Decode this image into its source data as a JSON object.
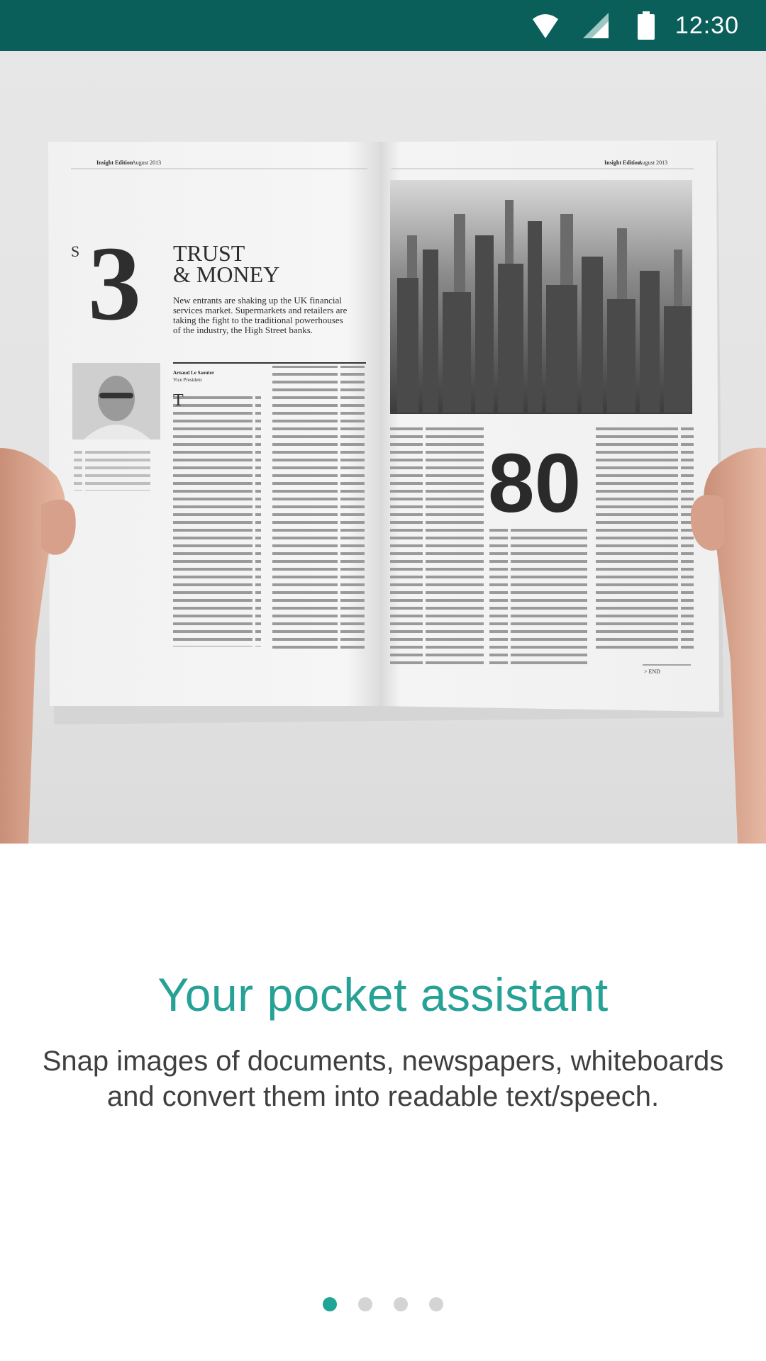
{
  "status_bar": {
    "time": "12:30",
    "icons": [
      "wifi-icon",
      "cell-signal-icon",
      "battery-icon"
    ]
  },
  "hero": {
    "magazine": {
      "left_page": {
        "edition": "Insight Edition",
        "edition_date": "August 2013",
        "number": "3",
        "heading_line1": "TRUST",
        "heading_line2": "& MONEY",
        "intro_lines": [
          "New entrants are shaking up the UK financial",
          "services market. Supermarkets and retailers are",
          "taking the fight to the traditional powerhouses",
          "of the industry, the High Street banks."
        ],
        "author_name": "Arnaud Le Saouter",
        "author_role": "Vice President"
      },
      "right_page": {
        "edition": "Insight Edition",
        "edition_date": "August 2013",
        "big_number": "80",
        "end_label": "> END"
      }
    }
  },
  "onboarding": {
    "title": "Your pocket assistant",
    "description_line1": "Snap images of documents, newspapers, whiteboards",
    "description_line2": "and convert them into readable text/speech."
  },
  "pager": {
    "total": 4,
    "active_index": 0
  },
  "colors": {
    "status_bar": "#0b5f5b",
    "accent": "#26a196",
    "dot_active": "#1fa495",
    "dot_inactive": "#d4d4d4"
  }
}
